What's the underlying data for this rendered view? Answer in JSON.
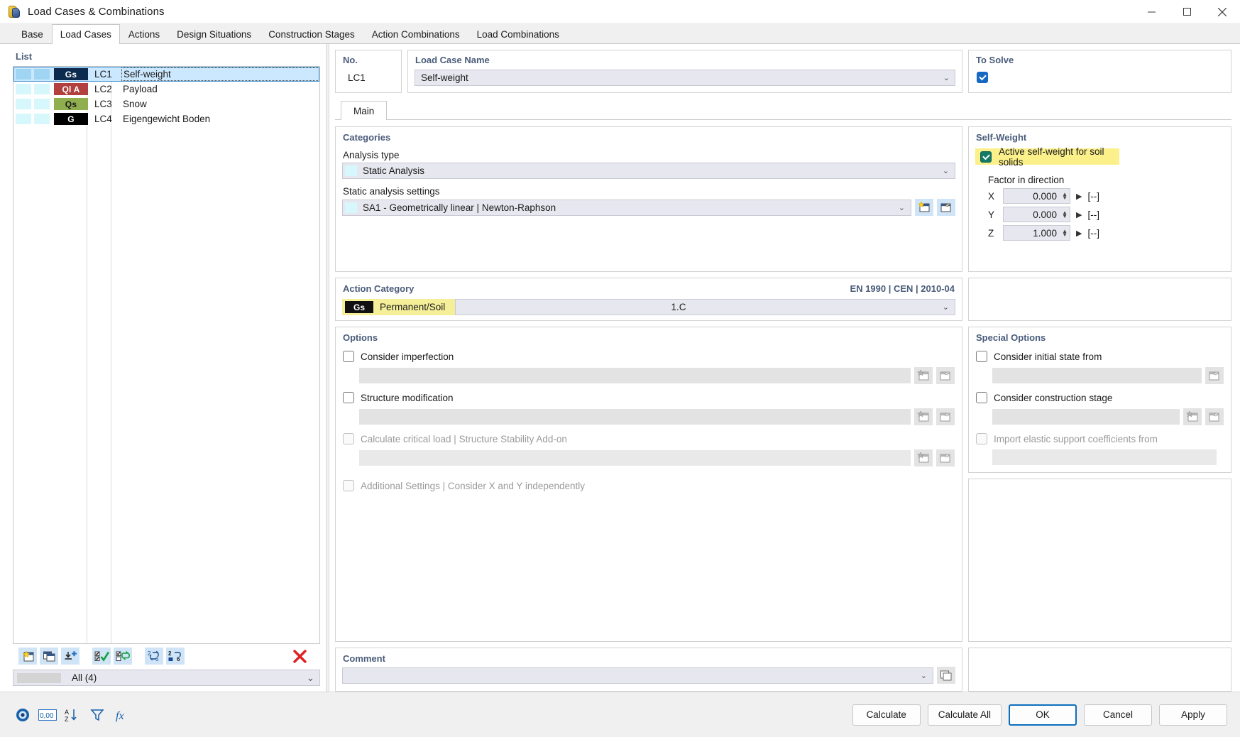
{
  "window": {
    "title": "Load Cases & Combinations",
    "icon": "load-case-icon",
    "minimize": "—",
    "maximize": "□",
    "close": "✕"
  },
  "tabs": [
    {
      "label": "Base",
      "active": false
    },
    {
      "label": "Load Cases",
      "active": true
    },
    {
      "label": "Actions",
      "active": false
    },
    {
      "label": "Design Situations",
      "active": false
    },
    {
      "label": "Construction Stages",
      "active": false
    },
    {
      "label": "Action Combinations",
      "active": false
    },
    {
      "label": "Load Combinations",
      "active": false
    }
  ],
  "list": {
    "caption": "List",
    "rows": [
      {
        "badge": "Gs",
        "badge_bg": "#0d2b4e",
        "badge_fg": "#ffffff",
        "no": "LC1",
        "name": "Self-weight",
        "selected": true
      },
      {
        "badge": "Ql A",
        "badge_bg": "#b1403f",
        "badge_fg": "#ffffff",
        "no": "LC2",
        "name": "Payload",
        "selected": false
      },
      {
        "badge": "Qs",
        "badge_bg": "#8fae4e",
        "badge_fg": "#1a1a1a",
        "no": "LC3",
        "name": "Snow",
        "selected": false
      },
      {
        "badge": "G",
        "badge_bg": "#000000",
        "badge_fg": "#ffffff",
        "no": "LC4",
        "name": "Eigengewicht Boden",
        "selected": false
      }
    ],
    "toolbar": [
      {
        "name": "new-load-case-icon",
        "glyph": "new"
      },
      {
        "name": "copy-load-case-icon",
        "glyph": "copy"
      },
      {
        "name": "import-load-case-icon",
        "glyph": "import"
      },
      {
        "name": "select-all-icon",
        "glyph": "checkall"
      },
      {
        "name": "invert-selection-icon",
        "glyph": "checkswap"
      },
      {
        "name": "renumber-icon",
        "glyph": "renumber"
      },
      {
        "name": "sort-icon",
        "glyph": "sort"
      },
      {
        "name": "delete-icon",
        "glyph": "delete"
      }
    ],
    "filter_value": "All (4)"
  },
  "header": {
    "no_label": "No.",
    "no_value": "LC1",
    "name_label": "Load Case Name",
    "name_value": "Self-weight",
    "to_solve_label": "To Solve",
    "to_solve_checked": true
  },
  "main_tab": {
    "label": "Main"
  },
  "categories": {
    "title": "Categories",
    "analysis_type_label": "Analysis type",
    "analysis_type_value": "Static Analysis",
    "static_settings_label": "Static analysis settings",
    "static_settings_value": "SA1 - Geometrically linear | Newton-Raphson"
  },
  "action_category": {
    "title": "Action Category",
    "standard": "EN 1990 | CEN | 2010-04",
    "badge": "Gs",
    "label": "Permanent/Soil",
    "value": "1.C"
  },
  "options": {
    "title": "Options",
    "items": [
      {
        "label": "Consider imperfection",
        "checked": false,
        "disabled": false,
        "has_field": true,
        "buttons": 2
      },
      {
        "label": "Structure modification",
        "checked": false,
        "disabled": false,
        "has_field": true,
        "buttons": 2
      },
      {
        "label": "Calculate critical load | Structure Stability Add-on",
        "checked": false,
        "disabled": true,
        "has_field": true,
        "buttons": 2
      },
      {
        "label": "Additional Settings | Consider X and Y independently",
        "checked": false,
        "disabled": true,
        "has_field": false,
        "buttons": 0
      }
    ]
  },
  "self_weight": {
    "title": "Self-Weight",
    "active_label": "Active self-weight for soil solids",
    "active_checked": true,
    "factor_label": "Factor in direction",
    "factors": [
      {
        "axis": "X",
        "value": "0.000",
        "unit": "[--]"
      },
      {
        "axis": "Y",
        "value": "0.000",
        "unit": "[--]"
      },
      {
        "axis": "Z",
        "value": "1.000",
        "unit": "[--]"
      }
    ]
  },
  "special_options": {
    "title": "Special Options",
    "items": [
      {
        "label": "Consider initial state from",
        "checked": false,
        "disabled": false,
        "has_field": true,
        "buttons": 1
      },
      {
        "label": "Consider construction stage",
        "checked": false,
        "disabled": false,
        "has_field": true,
        "buttons": 2
      },
      {
        "label": "Import elastic support coefficients from",
        "checked": false,
        "disabled": true,
        "has_field": true,
        "buttons": 0
      }
    ]
  },
  "comment": {
    "title": "Comment",
    "value": ""
  },
  "footer": {
    "tools": [
      {
        "name": "help-icon"
      },
      {
        "name": "units-icon",
        "text": "0,00"
      },
      {
        "name": "sort-table-icon"
      },
      {
        "name": "filter-icon"
      },
      {
        "name": "formula-icon"
      }
    ],
    "buttons": [
      {
        "label": "Calculate",
        "primary": false
      },
      {
        "label": "Calculate All",
        "primary": false
      },
      {
        "label": "OK",
        "primary": true
      },
      {
        "label": "Cancel",
        "primary": false
      },
      {
        "label": "Apply",
        "primary": false
      }
    ]
  }
}
